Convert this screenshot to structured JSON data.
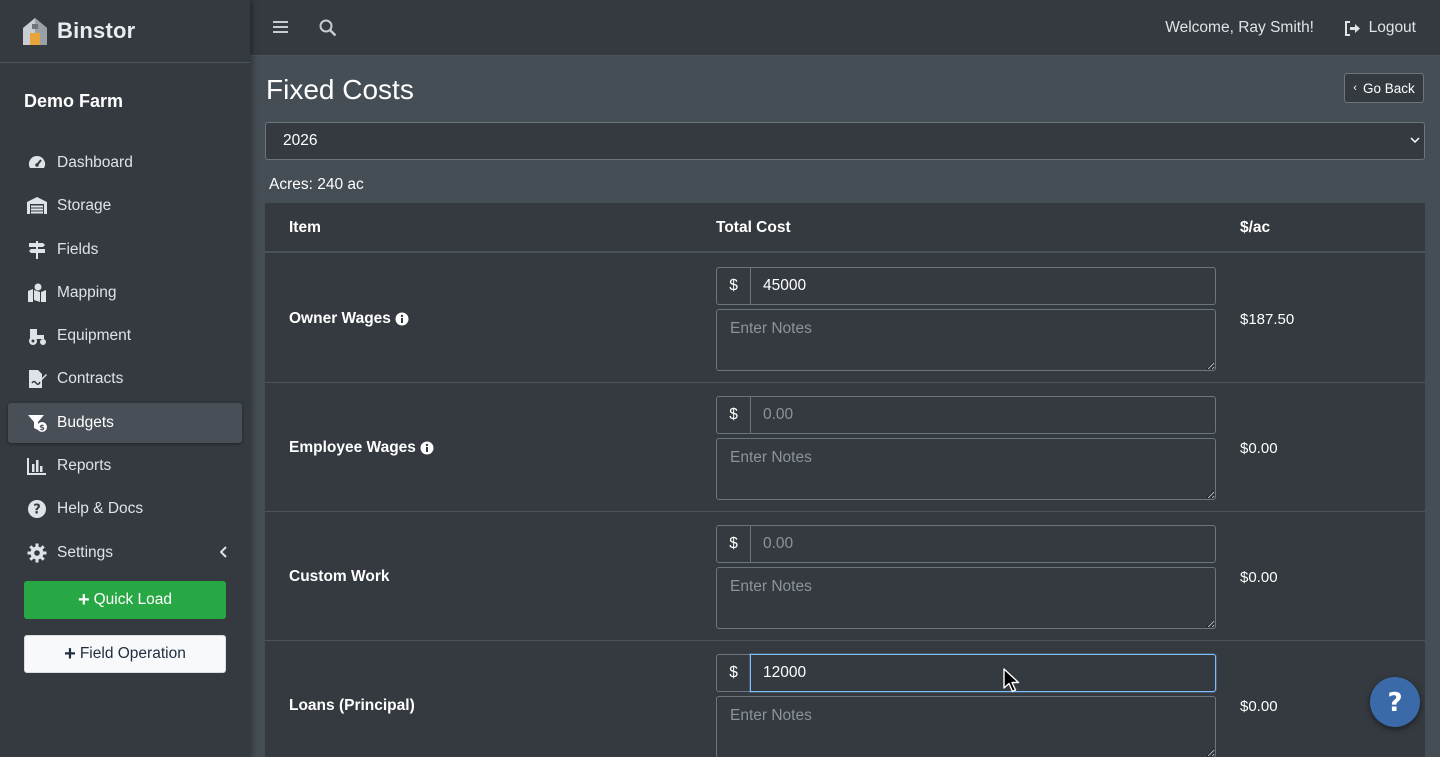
{
  "brand": {
    "name": "Binstor",
    "logo_icon": "barn-icon"
  },
  "farm": {
    "name": "Demo Farm"
  },
  "sidebar": {
    "items": [
      {
        "label": "Dashboard",
        "icon": "tachometer-icon",
        "active": false
      },
      {
        "label": "Storage",
        "icon": "warehouse-icon",
        "active": false
      },
      {
        "label": "Fields",
        "icon": "signs-icon",
        "active": false
      },
      {
        "label": "Mapping",
        "icon": "map-marked-icon",
        "active": false
      },
      {
        "label": "Equipment",
        "icon": "tractor-icon",
        "active": false
      },
      {
        "label": "Contracts",
        "icon": "file-signature-icon",
        "active": false
      },
      {
        "label": "Budgets",
        "icon": "funnel-dollar-icon",
        "active": true
      },
      {
        "label": "Reports",
        "icon": "chart-bar-icon",
        "active": false
      },
      {
        "label": "Help & Docs",
        "icon": "question-circle-icon",
        "active": false
      },
      {
        "label": "Settings",
        "icon": "cog-icon",
        "active": false
      }
    ],
    "quick_load_label": "Quick Load",
    "field_operation_label": "Field Operation"
  },
  "topbar": {
    "welcome": "Welcome, Ray Smith!",
    "logout_label": "Logout"
  },
  "page": {
    "title": "Fixed Costs",
    "go_back_label": "Go Back",
    "year": "2026",
    "acres_text": "Acres: 240 ac"
  },
  "table": {
    "headers": {
      "item": "Item",
      "total_cost": "Total Cost",
      "per_acre": "$/ac"
    },
    "currency_symbol": "$",
    "notes_placeholder": "Enter Notes",
    "cost_placeholder": "0.00",
    "rows": [
      {
        "label": "Owner Wages",
        "has_info": true,
        "value": "45000",
        "per_acre": "$187.50"
      },
      {
        "label": "Employee Wages",
        "has_info": true,
        "value": "",
        "per_acre": "$0.00"
      },
      {
        "label": "Custom Work",
        "has_info": false,
        "value": "",
        "per_acre": "$0.00"
      },
      {
        "label": "Loans (Principal)",
        "has_info": false,
        "value": "12000",
        "per_acre": "$0.00"
      }
    ]
  },
  "colors": {
    "sidebar_bg": "#343a40",
    "content_bg": "#454d55",
    "success": "#28a745",
    "help_fab": "#3b6aa8",
    "focus": "#80bdff"
  }
}
